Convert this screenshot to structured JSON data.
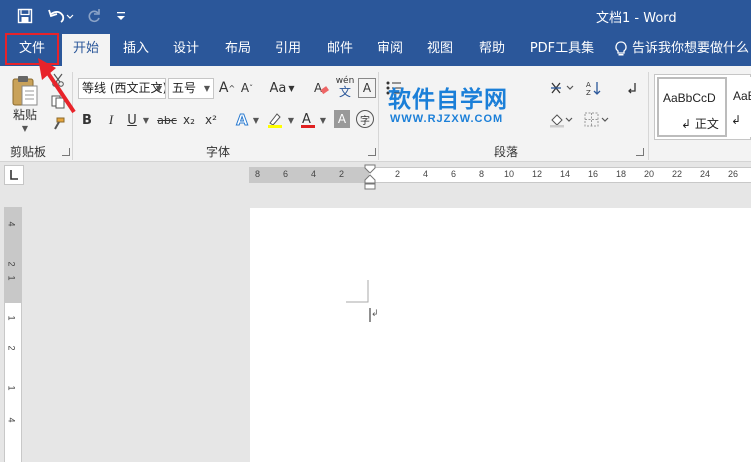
{
  "title_bar": {
    "document_title": "文档1 - Word",
    "quick_access": {
      "save_icon": "save-icon",
      "undo_icon": "undo-icon",
      "redo_icon": "redo-icon",
      "customize_icon": "customize-qat-icon"
    }
  },
  "tabs": [
    {
      "label": "文件",
      "id": "file"
    },
    {
      "label": "开始",
      "id": "home"
    },
    {
      "label": "插入",
      "id": "insert"
    },
    {
      "label": "设计",
      "id": "design"
    },
    {
      "label": "布局",
      "id": "layout"
    },
    {
      "label": "引用",
      "id": "references"
    },
    {
      "label": "邮件",
      "id": "mailings"
    },
    {
      "label": "审阅",
      "id": "review"
    },
    {
      "label": "视图",
      "id": "view"
    },
    {
      "label": "帮助",
      "id": "help"
    },
    {
      "label": "PDF工具集",
      "id": "pdf"
    }
  ],
  "tell_me": {
    "label": "告诉我你想要做什么"
  },
  "ribbon": {
    "clipboard": {
      "label": "剪贴板",
      "paste_label": "粘贴"
    },
    "font": {
      "label": "字体",
      "font_name": "等线 (西文正文)",
      "font_size": "五号",
      "case_label": "Aa",
      "phonetic_top": "wén",
      "phonetic_bottom": "文",
      "bold": "B",
      "italic": "I",
      "underline": "U",
      "strike": "abc",
      "subscript": "x₂",
      "superscript": "x²",
      "effects": "A",
      "char_border": "A",
      "enclose": "字"
    },
    "paragraph": {
      "label": "段落"
    },
    "styles": {
      "items": [
        {
          "sample": "AaBbCcD",
          "name": "正文"
        },
        {
          "sample": "AaB",
          "name": ""
        }
      ]
    }
  },
  "watermark": {
    "title": "软件自学网",
    "subtitle": "WWW.RJZXW.COM"
  },
  "ruler": {
    "horizontal_ticks": [
      "8",
      "6",
      "4",
      "2",
      "2",
      "4",
      "6",
      "8",
      "10",
      "12",
      "14",
      "16",
      "18",
      "20",
      "22",
      "24",
      "26"
    ],
    "vertical_ticks": [
      "4",
      "2",
      "1",
      "1",
      "2",
      "1",
      "4"
    ]
  },
  "colors": {
    "title_bar": "#2b579a",
    "ribbon": "#f3f3f3",
    "highlight_box": "#e8232a",
    "watermark": "#1b7fd8"
  }
}
